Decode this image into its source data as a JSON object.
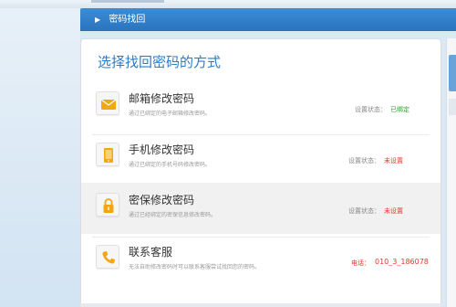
{
  "breadcrumb": {
    "arrow": "▶",
    "label": "密码找回"
  },
  "panel": {
    "title": "选择找回密码的方式"
  },
  "options": [
    {
      "icon": "envelope-icon",
      "name": "邮箱修改密码",
      "desc": "通过已绑定的电子邮箱修改密码。",
      "status_label": "设置状态：",
      "status_value": "已绑定",
      "status_color": "#28a228"
    },
    {
      "icon": "mobile-phone-icon",
      "name": "手机修改密码",
      "desc": "通过已绑定的手机号码修改密码。",
      "status_label": "设置状态：",
      "status_value": "未设置",
      "status_color": "#e03a2c"
    },
    {
      "icon": "lock-icon",
      "name": "密保修改密码",
      "desc": "通过已经绑定的密保信息修改密码。",
      "status_label": "设置状态：",
      "status_value": "未设置",
      "status_color": "#e03a2c"
    },
    {
      "icon": "telephone-icon",
      "name": "联系客服",
      "desc": "无法自助修改密码时可以联系客服尝试找回您的密码。",
      "status_label": "电话：",
      "status_value": "010_3_186078",
      "status_color": "#e03a2c"
    }
  ],
  "colors": {
    "accent": "#2c7cc6",
    "header_bar": "#2a74bf",
    "icon_orange": "#f2a614"
  }
}
